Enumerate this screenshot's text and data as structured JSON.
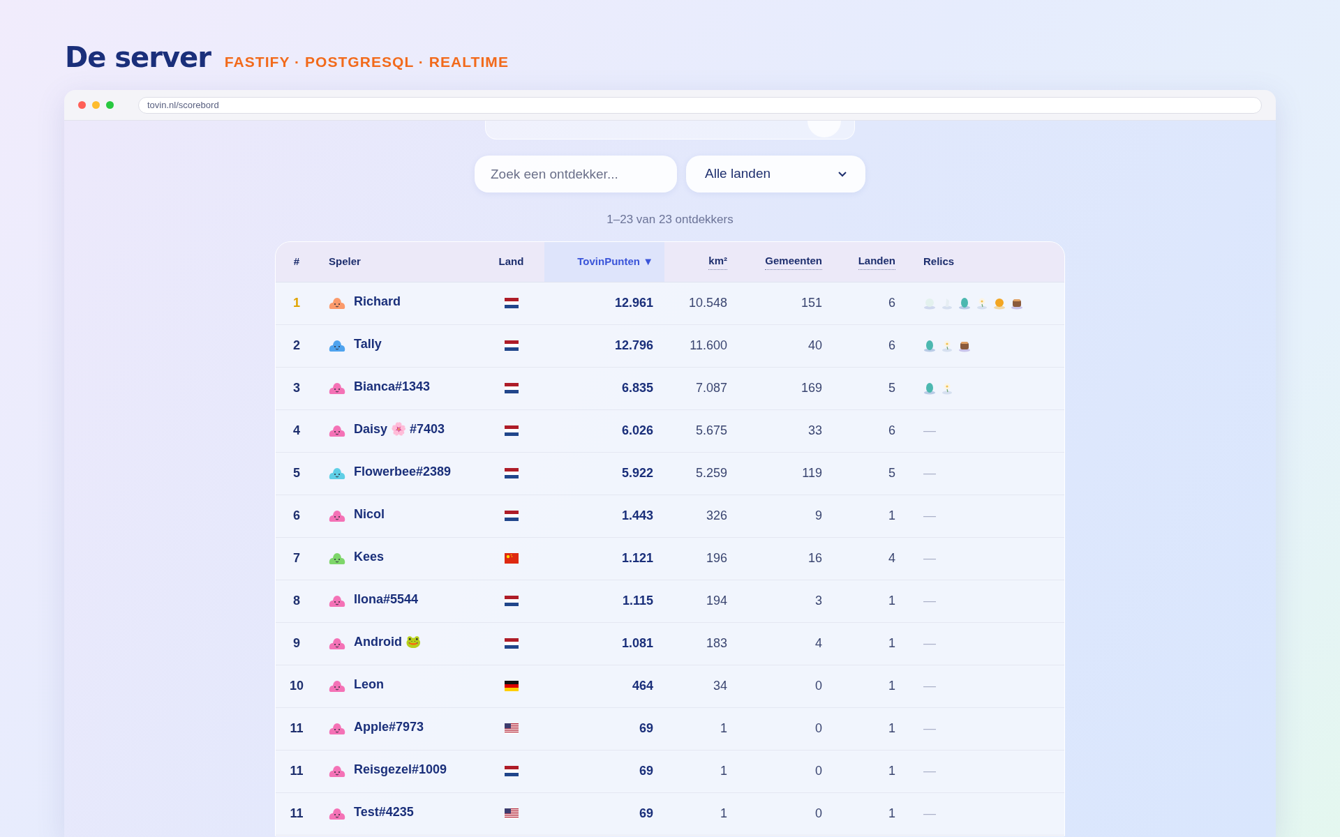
{
  "heading": {
    "title": "De server",
    "subtitle": "FASTIFY · POSTGRESQL · REALTIME"
  },
  "browser": {
    "url": "tovin.nl/scorebord"
  },
  "filters": {
    "search": {
      "placeholder": "Zoek een ontdekker..."
    },
    "country": {
      "value": "Alle landen"
    }
  },
  "result_count": "1–23 van 23 ontdekkers",
  "table": {
    "columns": [
      {
        "label": "#",
        "selected": false,
        "dotted": false
      },
      {
        "label": "Speler",
        "selected": false,
        "dotted": false
      },
      {
        "label": "Land",
        "selected": false,
        "dotted": false
      },
      {
        "label": "TovinPunten",
        "sort_indicator": "▼",
        "selected": true,
        "dotted": false
      },
      {
        "label": "km²",
        "selected": false,
        "dotted": true
      },
      {
        "label": "Gemeenten",
        "selected": false,
        "dotted": true
      },
      {
        "label": "Landen",
        "selected": false,
        "dotted": true
      },
      {
        "label": "Relics",
        "selected": false,
        "dotted": false
      }
    ],
    "rows": [
      {
        "rank": "1",
        "podium": true,
        "avatar": {
          "color": "#fb9a6b"
        },
        "name": "Richard",
        "flag": {
          "kind": "nl"
        },
        "points": "12.961",
        "km2": "10.548",
        "municipalities": "151",
        "countries": "6",
        "relics": [
          {
            "kind": "pearl"
          },
          {
            "kind": "crystal"
          },
          {
            "kind": "egg"
          },
          {
            "kind": "flower"
          },
          {
            "kind": "orb"
          },
          {
            "kind": "cake"
          }
        ]
      },
      {
        "rank": "2",
        "podium": false,
        "avatar": {
          "color": "#4fa3ee"
        },
        "name": "Tally",
        "flag": {
          "kind": "nl"
        },
        "points": "12.796",
        "km2": "11.600",
        "municipalities": "40",
        "countries": "6",
        "relics": [
          {
            "kind": "egg"
          },
          {
            "kind": "flower"
          },
          {
            "kind": "cake"
          }
        ]
      },
      {
        "rank": "3",
        "podium": false,
        "avatar": {
          "color": "#f472b6"
        },
        "name": "Bianca#1343",
        "flag": {
          "kind": "nl"
        },
        "points": "6.835",
        "km2": "7.087",
        "municipalities": "169",
        "countries": "5",
        "relics": [
          {
            "kind": "egg"
          },
          {
            "kind": "flower"
          }
        ]
      },
      {
        "rank": "4",
        "podium": false,
        "avatar": {
          "color": "#f472b6"
        },
        "name": "Daisy 🌸 #7403",
        "flag": {
          "kind": "nl"
        },
        "points": "6.026",
        "km2": "5.675",
        "municipalities": "33",
        "countries": "6",
        "no_relics": "—"
      },
      {
        "rank": "5",
        "podium": false,
        "avatar": {
          "color": "#5fcfe6"
        },
        "name": "Flowerbee#2389",
        "flag": {
          "kind": "nl"
        },
        "points": "5.922",
        "km2": "5.259",
        "municipalities": "119",
        "countries": "5",
        "no_relics": "—"
      },
      {
        "rank": "6",
        "podium": false,
        "avatar": {
          "color": "#f472b6"
        },
        "name": "Nicol",
        "flag": {
          "kind": "nl"
        },
        "points": "1.443",
        "km2": "326",
        "municipalities": "9",
        "countries": "1",
        "no_relics": "—"
      },
      {
        "rank": "7",
        "podium": false,
        "avatar": {
          "color": "#7ed66a"
        },
        "name": "Kees",
        "flag": {
          "kind": "cn"
        },
        "points": "1.121",
        "km2": "196",
        "municipalities": "16",
        "countries": "4",
        "no_relics": "—"
      },
      {
        "rank": "8",
        "podium": false,
        "avatar": {
          "color": "#f472b6"
        },
        "name": "Ilona#5544",
        "flag": {
          "kind": "nl"
        },
        "points": "1.115",
        "km2": "194",
        "municipalities": "3",
        "countries": "1",
        "no_relics": "—"
      },
      {
        "rank": "9",
        "podium": false,
        "avatar": {
          "color": "#f472b6"
        },
        "name": "Android 🐸",
        "flag": {
          "kind": "nl"
        },
        "points": "1.081",
        "km2": "183",
        "municipalities": "4",
        "countries": "1",
        "no_relics": "—"
      },
      {
        "rank": "10",
        "podium": false,
        "avatar": {
          "color": "#f472b6"
        },
        "name": "Leon",
        "flag": {
          "kind": "de"
        },
        "points": "464",
        "km2": "34",
        "municipalities": "0",
        "countries": "1",
        "no_relics": "—"
      },
      {
        "rank": "11",
        "podium": false,
        "avatar": {
          "color": "#f472b6"
        },
        "name": "Apple#7973",
        "flag": {
          "kind": "us"
        },
        "points": "69",
        "km2": "1",
        "municipalities": "0",
        "countries": "1",
        "no_relics": "—"
      },
      {
        "rank": "11",
        "podium": false,
        "avatar": {
          "color": "#f472b6"
        },
        "name": "Reisgezel#1009",
        "flag": {
          "kind": "nl"
        },
        "points": "69",
        "km2": "1",
        "municipalities": "0",
        "countries": "1",
        "no_relics": "—"
      },
      {
        "rank": "11",
        "podium": false,
        "avatar": {
          "color": "#f472b6"
        },
        "name": "Test#4235",
        "flag": {
          "kind": "us"
        },
        "points": "69",
        "km2": "1",
        "municipalities": "0",
        "countries": "1",
        "no_relics": "—"
      }
    ]
  }
}
